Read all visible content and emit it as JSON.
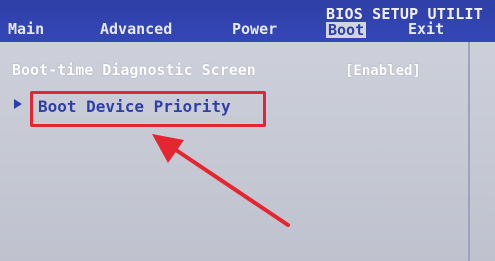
{
  "header": {
    "title": "BIOS SETUP UTILIT"
  },
  "tabs": [
    {
      "label": "Main"
    },
    {
      "label": "Advanced"
    },
    {
      "label": "Power"
    },
    {
      "label": "Boot",
      "selected": true
    },
    {
      "label": "Exit"
    }
  ],
  "items": [
    {
      "label": "Boot-time Diagnostic Screen",
      "value": "[Enabled]"
    },
    {
      "label": "Boot Device Priority",
      "submenu": true
    }
  ],
  "annotation": {
    "highlight_color": "#e3262f",
    "arrow_color": "#e3262f"
  },
  "colors": {
    "header_blue": "#2f3fa8",
    "background_gray": "#c9ccd8"
  }
}
